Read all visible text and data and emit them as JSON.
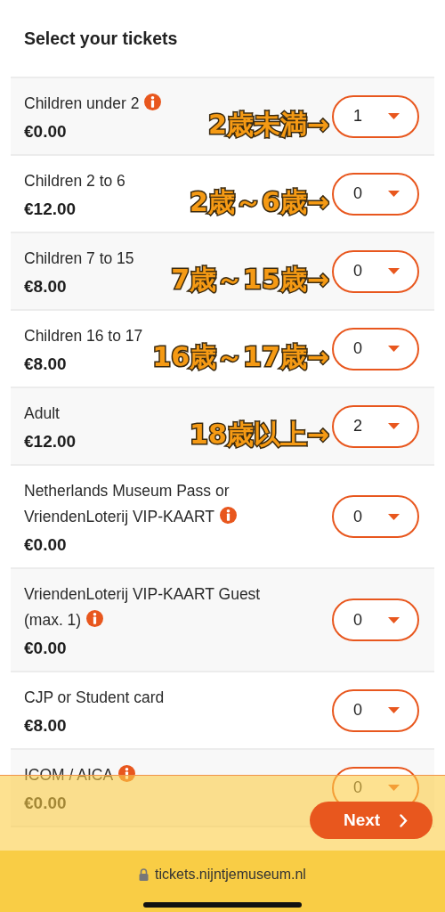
{
  "heading": "Select your tickets",
  "tickets": [
    {
      "name": "Children under 2",
      "info": true,
      "price": "€0.00",
      "quantity": "1",
      "annotation": "2歳未満→"
    },
    {
      "name": "Children 2 to 6",
      "info": false,
      "price": "€12.00",
      "quantity": "0",
      "annotation": "2歳～6歳→"
    },
    {
      "name": "Children 7 to 15",
      "info": false,
      "price": "€8.00",
      "quantity": "0",
      "annotation": "7歳～15歳→"
    },
    {
      "name": "Children 16 to 17",
      "info": false,
      "price": "€8.00",
      "quantity": "0",
      "annotation": "16歳～17歳→"
    },
    {
      "name": "Adult",
      "info": false,
      "price": "€12.00",
      "quantity": "2",
      "annotation": "18歳以上→"
    },
    {
      "name": "Netherlands Museum Pass or VriendenLoterij VIP-KAART",
      "info": true,
      "price": "€0.00",
      "quantity": "0"
    },
    {
      "name": "VriendenLoterij VIP-KAART Guest (max. 1)",
      "info": true,
      "price": "€0.00",
      "quantity": "0"
    },
    {
      "name": "CJP or Student card",
      "info": false,
      "price": "€8.00",
      "quantity": "0"
    },
    {
      "name": "ICOM / AICA",
      "info": true,
      "price": "€0.00",
      "quantity": "0"
    }
  ],
  "next_button": {
    "label": "Next"
  },
  "browser_bar": {
    "url": "tickets.nijntjemuseum.nl"
  }
}
